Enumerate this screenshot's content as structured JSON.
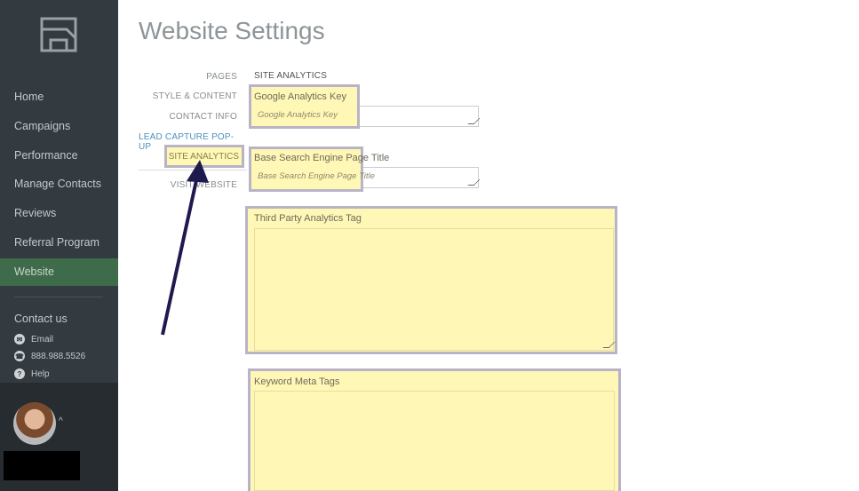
{
  "sidebar": {
    "nav": [
      {
        "label": "Home"
      },
      {
        "label": "Campaigns"
      },
      {
        "label": "Performance"
      },
      {
        "label": "Manage Contacts"
      },
      {
        "label": "Reviews"
      },
      {
        "label": "Referral Program"
      },
      {
        "label": "Website",
        "active": true
      }
    ],
    "contact": {
      "title": "Contact us",
      "email": "Email",
      "phone": "888.988.5526",
      "help": "Help"
    }
  },
  "page": {
    "title": "Website Settings"
  },
  "subnav": {
    "pages": "PAGES",
    "style": "STYLE & CONTENT",
    "contact": "CONTACT INFO",
    "lead": "LEAD CAPTURE POP-UP",
    "analytics": "SITE ANALYTICS",
    "visit": "VISIT WEBSITE"
  },
  "form": {
    "section_title": "SITE ANALYTICS",
    "ga_key_label": "Google Analytics Key",
    "ga_key_placeholder": "Google Analytics Key",
    "base_title_label": "Base Search Engine Page Title",
    "base_title_placeholder": "Base Search Engine Page Title",
    "third_party_label": "Third Party Analytics Tag",
    "keyword_label": "Keyword Meta Tags"
  },
  "colors": {
    "sidebar_bg": "#333b40",
    "active_nav": "#3e6b4a",
    "highlight": "#fff7b5",
    "highlight_border": "#b8b4c6",
    "arrow": "#1f1a4d",
    "link": "#4a90c4"
  }
}
